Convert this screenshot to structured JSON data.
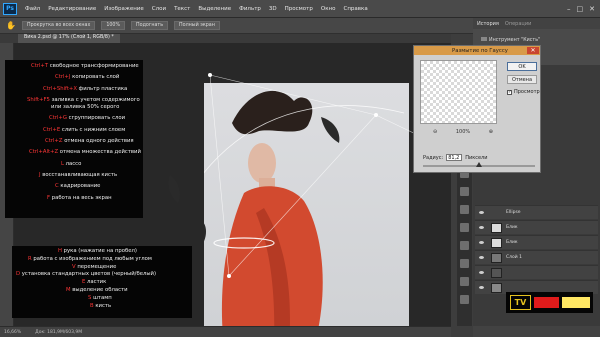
{
  "app": {
    "logo": "Ps",
    "menu": [
      "Файл",
      "Редактирование",
      "Изображение",
      "Слои",
      "Текст",
      "Выделение",
      "Фильтр",
      "3D",
      "Просмотр",
      "Окно",
      "Справка"
    ],
    "window_controls": [
      "–",
      "□",
      "✕"
    ]
  },
  "options_bar": {
    "buttons": [
      "Прокрутка во всех окнах",
      "100%",
      "Подогнать",
      "Полный экран"
    ]
  },
  "document": {
    "tab_label": "Вика 2.psd @ 17% (Слой 1, RGB/8) *",
    "zoom": "16,66%",
    "doc_info": "Док: 181,9M/603,9M"
  },
  "shortcuts_top": [
    {
      "key": "Ctrl+T",
      "desc": "свободное трансформирование"
    },
    {
      "key": "Ctrl+J",
      "desc": "копировать слой"
    },
    {
      "key": "Ctrl+Shift+X",
      "desc": "фильтр пластика"
    },
    {
      "key": "Shift+F5",
      "desc": "заливка с учетом содержимого"
    },
    {
      "key": "",
      "desc": "или заливка 50% серого"
    },
    {
      "key": "Ctrl+G",
      "desc": "сгруппировать слои"
    },
    {
      "key": "Ctrl+E",
      "desc": "слить с нижним слоем"
    },
    {
      "key": "Ctrl+Z",
      "desc": "отмена одного действия"
    },
    {
      "key": "Ctrl+Alt+Z",
      "desc": "отмена множества действий"
    },
    {
      "key": "L",
      "desc": "лассо"
    },
    {
      "key": "J",
      "desc": "восстанавливающая кисть"
    },
    {
      "key": "C",
      "desc": "кадрирование"
    },
    {
      "key": "F",
      "desc": "работа на весь экран"
    }
  ],
  "shortcuts_bottom": [
    {
      "key": "H",
      "desc": "рука (нажатие на пробел)"
    },
    {
      "key": "R",
      "desc": "работа с изображением под любым углом"
    },
    {
      "key": "V",
      "desc": "перемещение"
    },
    {
      "key": "D",
      "desc": "установка стандартных цветов (черный/белый)"
    },
    {
      "key": "E",
      "desc": "ластик"
    },
    {
      "key": "M",
      "desc": "выделение области"
    },
    {
      "key": "S",
      "desc": "штамп"
    },
    {
      "key": "B",
      "desc": "кисть"
    }
  ],
  "gaussian_dialog": {
    "title": "Размытие по Гауссу",
    "ok_label": "OK",
    "cancel_label": "Отмена",
    "preview_label": "Просмотр",
    "preview_checked": "✓",
    "zoom_out": "⊖",
    "zoom_value": "100%",
    "zoom_in": "⊕",
    "radius_label": "Радиус:",
    "radius_value": "81,2",
    "radius_unit": "Пиксели",
    "slider_value": 0.5,
    "close": "✕"
  },
  "panels": {
    "tab_history": "История",
    "tab_operations": "Операции",
    "history_item": "Инструмент \"Кисть\"",
    "layers": [
      "Ellipse",
      "Блик",
      "Блик",
      "Слой 1",
      "",
      "",
      "",
      "",
      "",
      ""
    ]
  },
  "watermark": {
    "logo": "TV",
    "red": "#e01b1b",
    "yellow": "#ffe763"
  }
}
